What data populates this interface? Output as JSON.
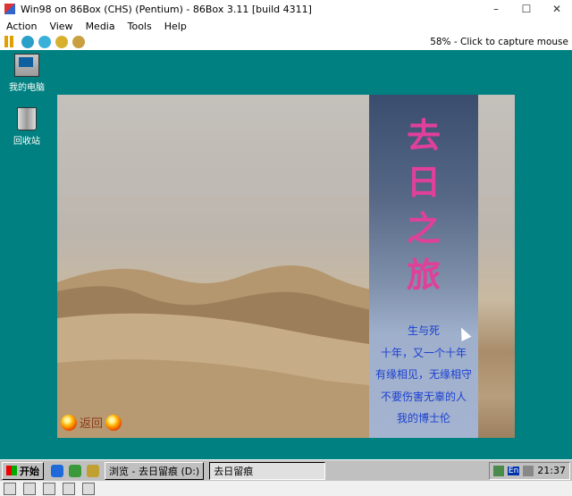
{
  "host": {
    "title": "Win98 on 86Box (CHS) (Pentium) - 86Box 3.11 [build 4311]",
    "minimize": "–",
    "maximize": "☐",
    "close": "✕",
    "menu": [
      "Action",
      "View",
      "Media",
      "Tools",
      "Help"
    ],
    "status_right": "58% - Click to capture mouse",
    "toolbar_icons": [
      "pause-icon",
      "reset-icon",
      "ctrl-alt-del-icon",
      "ctrl-alt-esc-icon",
      "settings-icon"
    ]
  },
  "desktop": {
    "icons": [
      {
        "label": "我的电脑",
        "icon": "my-computer-icon"
      },
      {
        "label": "回收站",
        "icon": "recycle-bin-icon"
      }
    ]
  },
  "app": {
    "title_chars": [
      "去",
      "日",
      "之",
      "旅"
    ],
    "poem": [
      "生与死",
      "十年，又一个十年",
      "有缘相见，无缘相守",
      "不要伤害无辜的人",
      "我的博士伦"
    ],
    "back_label": "返回"
  },
  "taskbar": {
    "start": "开始",
    "tasks": [
      "浏览 - 去日留痕 (D:)",
      "去日留痕"
    ],
    "clock": "21:37",
    "lang": "En"
  },
  "colors": {
    "desktop": "#008080",
    "title_text": "#e0409a",
    "poem_text": "#1a3fd0"
  }
}
